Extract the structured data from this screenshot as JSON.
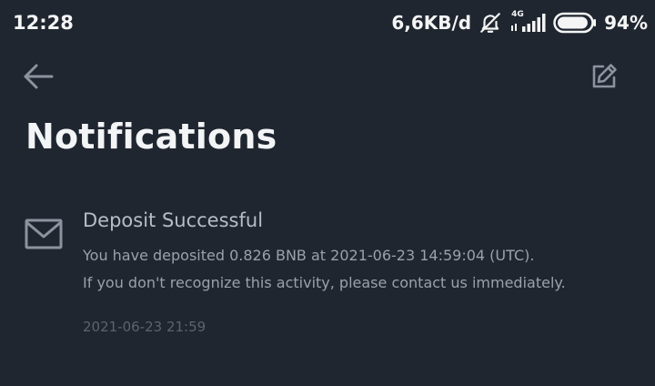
{
  "status_bar": {
    "time": "12:28",
    "net_speed": "6,6KB/d",
    "network_type": "4G",
    "battery_percent": "94%",
    "battery_level": 0.94,
    "icons": [
      "mute-bell-icon",
      "signal-icon",
      "battery-icon"
    ]
  },
  "header": {
    "back_icon": "arrow-left-icon",
    "edit_icon": "edit-square-icon"
  },
  "page": {
    "title": "Notifications"
  },
  "notifications": [
    {
      "icon": "mail-icon",
      "title": "Deposit Successful",
      "line1": "You have deposited 0.826 BNB at 2021-06-23 14:59:04 (UTC).",
      "line2": "If you don't recognize this activity, please contact us immediately.",
      "timestamp": "2021-06-23 21:59"
    }
  ],
  "colors": {
    "background": "#1f2630",
    "title": "#f3f4f6",
    "secondary": "#9aa1ab",
    "muted": "#5b636e",
    "icon": "#8a939e"
  }
}
